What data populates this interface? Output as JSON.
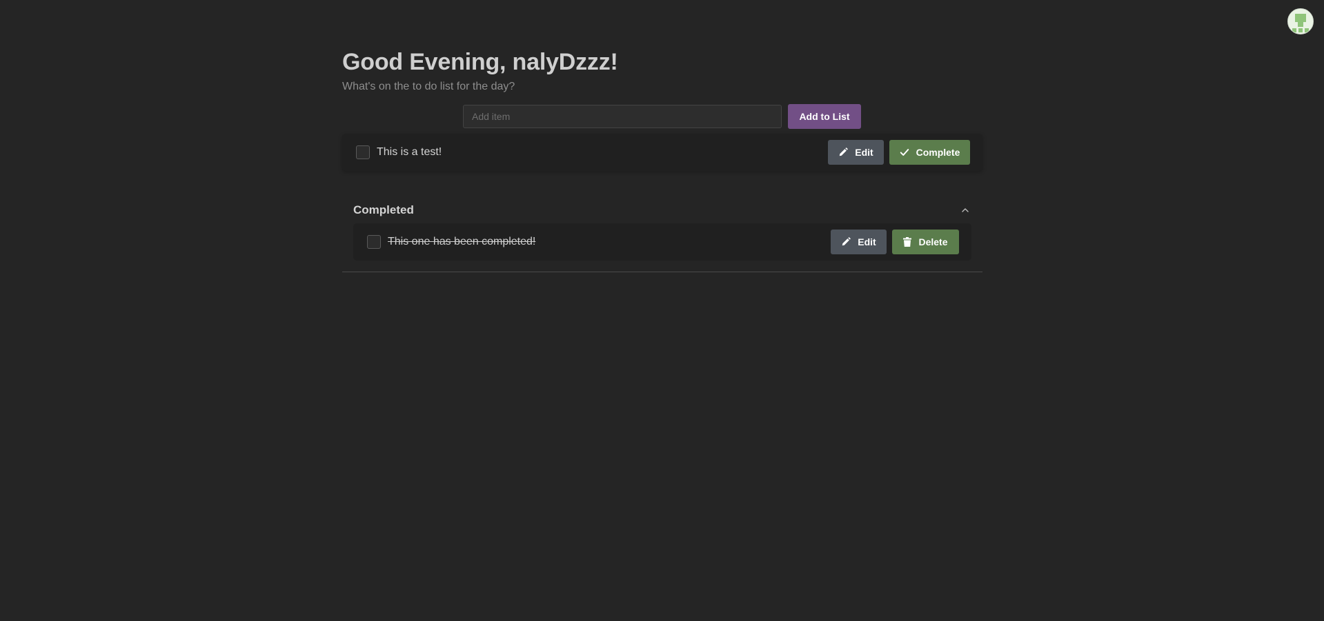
{
  "header": {
    "greeting": "Good Evening, nalyDzzz!",
    "subtitle": "What's on the to do list for the day?",
    "avatar_icon": "user-avatar-icon"
  },
  "add": {
    "placeholder": "Add item",
    "value": "",
    "button_label": "Add to List"
  },
  "todos": [
    {
      "text": "This is a test!",
      "checked": false,
      "edit_label": "Edit",
      "complete_label": "Complete"
    }
  ],
  "completed": {
    "title": "Completed",
    "expanded": true,
    "items": [
      {
        "text": "This one has been completed!",
        "checked": false,
        "edit_label": "Edit",
        "delete_label": "Delete"
      }
    ]
  },
  "colors": {
    "background": "#252525",
    "card": "#202020",
    "accent_purple": "#724f86",
    "success_green": "#5b7d4c",
    "edit_gray": "#4e545c"
  }
}
